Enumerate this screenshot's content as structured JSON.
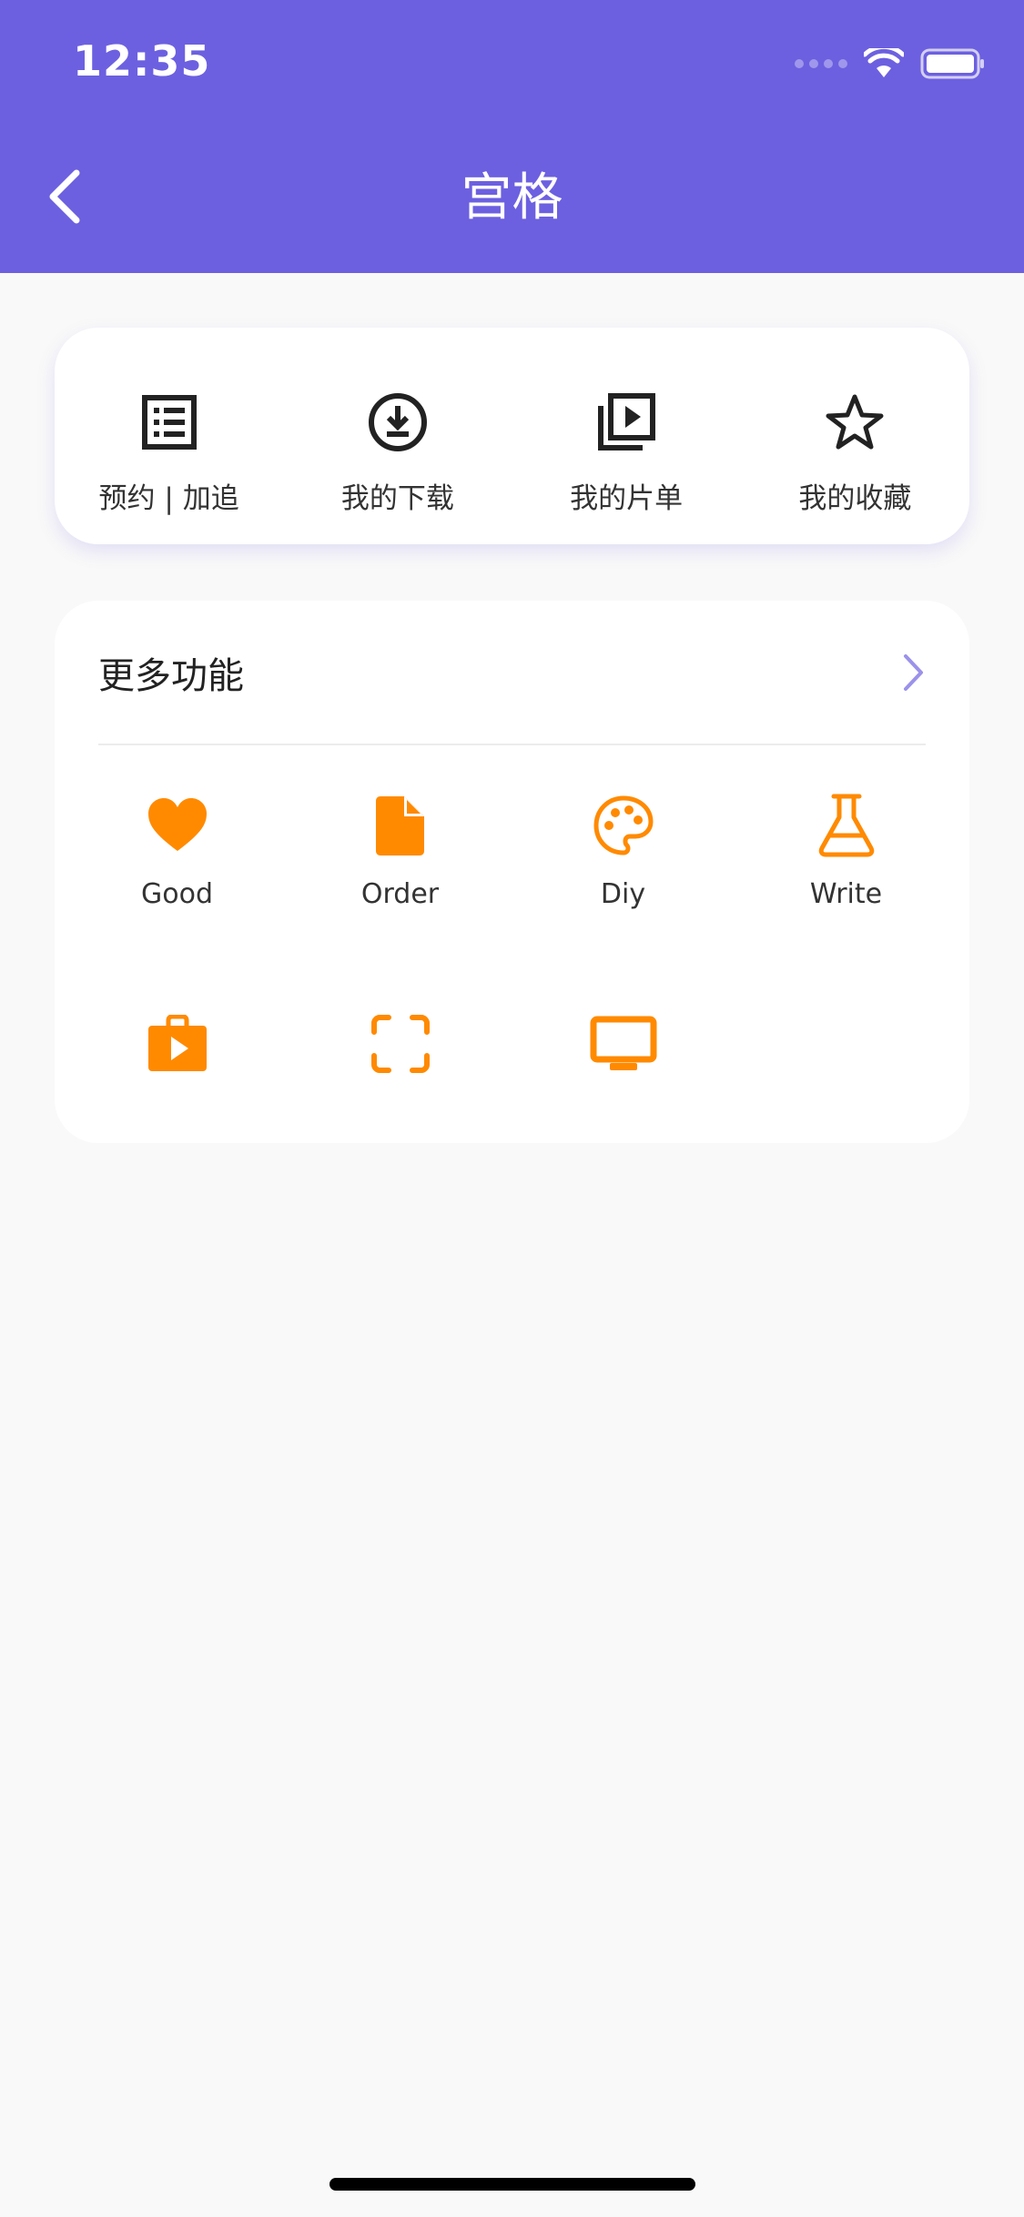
{
  "status_bar": {
    "time": "12:35"
  },
  "header": {
    "title": "宫格",
    "back_icon": "chevron-left-icon"
  },
  "colors": {
    "header_bg": "#6c60e0",
    "accent_orange": "#ff8a00",
    "icon_dark": "#222222",
    "chevron": "#9b92ea"
  },
  "quick_actions": [
    {
      "label": "预约 | 加追",
      "icon": "list-icon"
    },
    {
      "label": "我的下载",
      "icon": "download-circle-icon"
    },
    {
      "label": "我的片单",
      "icon": "video-library-icon"
    },
    {
      "label": "我的收藏",
      "icon": "star-icon"
    }
  ],
  "more_features": {
    "title": "更多功能",
    "chevron_icon": "chevron-right-icon",
    "items": [
      {
        "label": "Good",
        "icon": "heart-icon"
      },
      {
        "label": "Order",
        "icon": "document-icon"
      },
      {
        "label": "Diy",
        "icon": "palette-icon"
      },
      {
        "label": "Write",
        "icon": "flask-icon"
      },
      {
        "label": "",
        "icon": "video-briefcase-icon"
      },
      {
        "label": "",
        "icon": "scan-frame-icon"
      },
      {
        "label": "",
        "icon": "monitor-icon"
      }
    ]
  }
}
